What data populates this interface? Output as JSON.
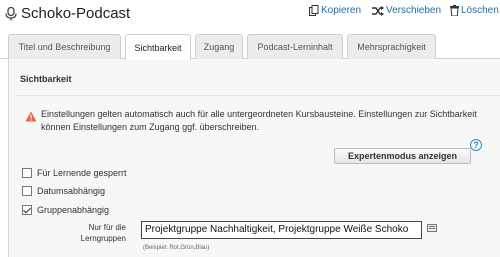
{
  "header": {
    "title": "Schoko-Podcast",
    "title_icon": "podcast-icon",
    "actions": [
      {
        "label": "Kopieren",
        "icon": "copy-icon"
      },
      {
        "label": "Verschieben",
        "icon": "move-icon"
      },
      {
        "label": "Löschen",
        "icon": "trash-icon"
      }
    ]
  },
  "tabs": [
    {
      "label": "Titel und Beschreibung",
      "active": false
    },
    {
      "label": "Sichtbarkeit",
      "active": true
    },
    {
      "label": "Zugang",
      "active": false
    },
    {
      "label": "Podcast-Lerninhalt",
      "active": false
    },
    {
      "label": "Mehrsprachigkeit",
      "active": false
    }
  ],
  "section": {
    "title": "Sichtbarkeit",
    "warning": "Einstellungen gelten automatisch auch für alle untergeordneten Kursbausteine. Einstellungen zur Sichtbarkeit können Einstellungen zum Zugang ggf. überschreiben.",
    "expert_button": "Expertenmodus anzeigen",
    "help": "?"
  },
  "options": [
    {
      "label": "Für Lernende gesperrt",
      "checked": false
    },
    {
      "label": "Datumsabhängig",
      "checked": false
    },
    {
      "label": "Gruppenabhängig",
      "checked": true
    }
  ],
  "groups_field": {
    "label": "Nur für die Lerngruppen",
    "value": "Projektgruppe Nachhaltigkeit, Projektgruppe Weiße Schoko",
    "hint": "(Beispiel: Rot,Grün,Blau)"
  },
  "colors": {
    "accent": "#1f6fa8",
    "warning": "#e8643c",
    "help": "#2a8fc8"
  }
}
